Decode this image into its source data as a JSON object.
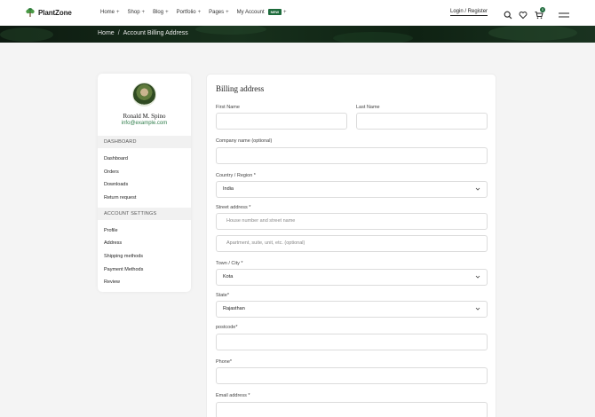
{
  "brand": {
    "name": "PlantZone"
  },
  "nav": [
    {
      "label": "Home"
    },
    {
      "label": "Shop"
    },
    {
      "label": "Blog"
    },
    {
      "label": "Portfolio"
    },
    {
      "label": "Pages"
    },
    {
      "label": "My Account",
      "badge": "NEW"
    }
  ],
  "header": {
    "login_label": "Login / Register",
    "cart_count": "0"
  },
  "breadcrumb": {
    "home": "Home",
    "current": "Account Billing Address"
  },
  "profile": {
    "name": "Ronald M. Spino",
    "email": "info@example.com"
  },
  "sidebar": {
    "dashboard_heading": "DASHBOARD",
    "dashboard_links": [
      "Dashboard",
      "Orders",
      "Downloads",
      "Return request"
    ],
    "settings_heading": "ACCOUNT SETTINGS",
    "settings_links": [
      "Profile",
      "Address",
      "Shipping methods",
      "Payment Methods",
      "Review"
    ]
  },
  "form": {
    "title": "Billing address",
    "first_name_label": "First Name",
    "last_name_label": "Last Name",
    "company_label": "Company name (optional)",
    "country_label": "Country / Region *",
    "country_value": "India",
    "street_label": "Street address *",
    "street_placeholder": "House number and street name",
    "apartment_placeholder": "Apartment, suite, unit, etc. (optional)",
    "town_label": "Town / City *",
    "town_value": "Kota",
    "state_label": "State*",
    "state_value": "Rajasthan",
    "postcode_label": "postcode*",
    "phone_label": "Phone*",
    "email_label": "Email address *"
  },
  "colors": {
    "accent": "#1e6b3c",
    "link": "#2e7d4a",
    "banner": "#17301c"
  }
}
